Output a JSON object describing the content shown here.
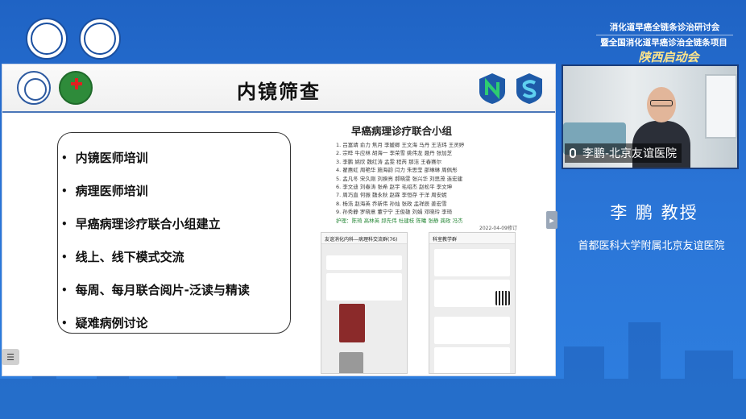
{
  "header": {
    "line1": "消化道早癌全链条诊治研讨会",
    "line2": "暨全国消化道早癌诊治全链条项目",
    "script_title": "陕西启动会"
  },
  "slide": {
    "title": "内镜筛查",
    "bullets": [
      "内镜医师培训",
      "病理医师培训",
      "早癌病理诊疗联合小组建立",
      "线上、线下模式交流",
      "每周、每月联合阅片-泛读与精读",
      "疑难病例讨论"
    ],
    "group": {
      "title": "早癌病理诊疗联合小组",
      "lines": [
        "1. 吕富靖 俞力 焦月 李媛卿 王文海 马丹 王洁玮 王灵婷",
        "2. 宗晔 牛应林 胡海一 李荣雪 姚伟龙 聂丹 张加芝",
        "3. 李鹏 姚欣 魏红涛 孟雯 程芮 那洁 王春赛尔",
        "4. 翟惠虹 周艳华 施海韵 闫力 朱思莹 邵琳琳 周佩彤",
        "5. 孟凡冬 宋久刚 刘揆亮 郝晓雯 张兴华 刘思茂 连宏建",
        "6. 李文迪 刘春涛 张希 赵宇 毛绍杰 赵松平 李文坤",
        "7. 周巧直 何振 魏永秋 赵霖 李恒存 于洋 周安妮",
        "8. 杨浩 赵海英 乔新伟 孙灿 张政 孟祥辰 姜宏雪",
        "9. 孙秀静 罗晓意 董宁宁 王俊雄 刘娟 邓晓玲 李琦"
      ],
      "nurse_line": "护理：陈琦 高林英 邱先伟 杜建枝 陈曦 张静 龚政 冯杰",
      "date": "2022-04-09修订"
    },
    "chat1_title": "友谊消化内科—病理科交流群(76)",
    "chat2_title": "科室教学群"
  },
  "video": {
    "label": "李鹏-北京友谊医院"
  },
  "speaker": {
    "name": "李 鹏 教授",
    "affiliation": "首都医科大学附属北京友谊医院"
  },
  "icons": {
    "menu": "list-icon",
    "arrow": "chevron-right-icon",
    "mic": "microphone-icon"
  }
}
